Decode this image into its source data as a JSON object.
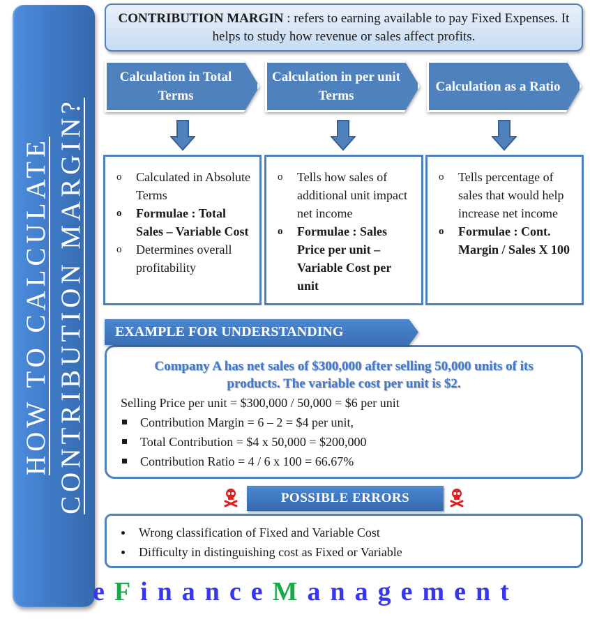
{
  "side_title": {
    "line1": "HOW TO CALCULATE",
    "line2": "CONTRIBUTION MARGIN?"
  },
  "definition": {
    "term": "CONTRIBUTION MARGIN",
    "text": " : refers to earning available to pay Fixed Expenses. It helps to study how revenue or sales affect profits."
  },
  "methods": [
    {
      "title": "Calculation in Total Terms",
      "points": [
        {
          "text": "Calculated in Absolute Terms",
          "bold": false
        },
        {
          "text": "Formulae : Total Sales – Variable Cost",
          "bold": true
        },
        {
          "text": "Determines overall profitability",
          "bold": false
        }
      ]
    },
    {
      "title": "Calculation in per unit Terms",
      "points": [
        {
          "text": "Tells how sales of additional unit impact net income",
          "bold": false
        },
        {
          "text": "Formulae : Sales Price per unit – Variable Cost per unit",
          "bold": true
        }
      ]
    },
    {
      "title": "Calculation as a Ratio",
      "points": [
        {
          "text": "Tells percentage of sales that would help increase net income",
          "bold": false
        },
        {
          "text": "Formulae : Cont. Margin / Sales X 100",
          "bold": true
        }
      ]
    }
  ],
  "bullet_glyph": "o",
  "example": {
    "header": "EXAMPLE FOR UNDERSTANDING",
    "lead": "Company A has net sales of $300,000 after selling 50,000 units of its products. The variable cost per unit is $2.",
    "first_line": "Selling Price per unit = $300,000 / 50,000 = $6 per unit",
    "items": [
      "Contribution Margin = 6 – 2 = $4 per unit,",
      "Total Contribution = $4 x 50,000 = $200,000",
      "Contribution Ratio = 4 / 6 x 100 = 66.67%"
    ]
  },
  "errors": {
    "header": "POSSIBLE  ERRORS",
    "icon": "skull-crossbones-icon",
    "items": [
      "Wrong classification of Fixed and Variable Cost",
      "Difficulty in distinguishing cost as Fixed or Variable"
    ]
  },
  "brand": {
    "part1": "e",
    "part2": "F",
    "part3": "inance",
    "part4": "M",
    "part5": "anagement"
  },
  "colors": {
    "primary_blue": "#4f81bd",
    "brand_blue": "#3636ee",
    "brand_green": "#1aa84a",
    "skull_red": "#e02020"
  }
}
